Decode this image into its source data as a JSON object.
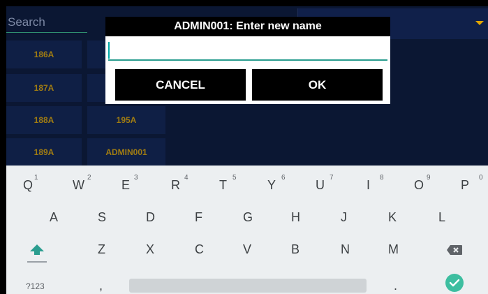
{
  "search": {
    "placeholder": "Search"
  },
  "tiles": [
    {
      "label": "186A"
    },
    {
      "label": "187A"
    },
    {
      "label": "188A"
    },
    {
      "label": "195A"
    },
    {
      "label": "189A"
    },
    {
      "label": "ADMIN001"
    }
  ],
  "dialog": {
    "title": "ADMIN001: Enter new name",
    "input_value": "",
    "cancel_label": "CANCEL",
    "ok_label": "OK"
  },
  "keyboard": {
    "row1": [
      "Q",
      "W",
      "E",
      "R",
      "T",
      "Y",
      "U",
      "I",
      "O",
      "P"
    ],
    "row1_hints": [
      "1",
      "2",
      "3",
      "4",
      "5",
      "6",
      "7",
      "8",
      "9",
      "0"
    ],
    "row2": [
      "A",
      "S",
      "D",
      "F",
      "G",
      "H",
      "J",
      "K",
      "L"
    ],
    "row3": [
      "Z",
      "X",
      "C",
      "V",
      "B",
      "N",
      "M"
    ],
    "symbols_label": "?123",
    "comma_label": ",",
    "period_label": "."
  },
  "colors": {
    "app_bg": "#0b1733",
    "tile_text": "#a07c12",
    "accent": "#2a9d8f",
    "dropdown_arrow": "#e2a500",
    "enter_key": "#3dbea0"
  },
  "icons": {
    "shift": "shift-arrow-icon",
    "backspace": "backspace-icon",
    "enter": "checkmark-icon",
    "dropdown": "caret-down-icon"
  }
}
